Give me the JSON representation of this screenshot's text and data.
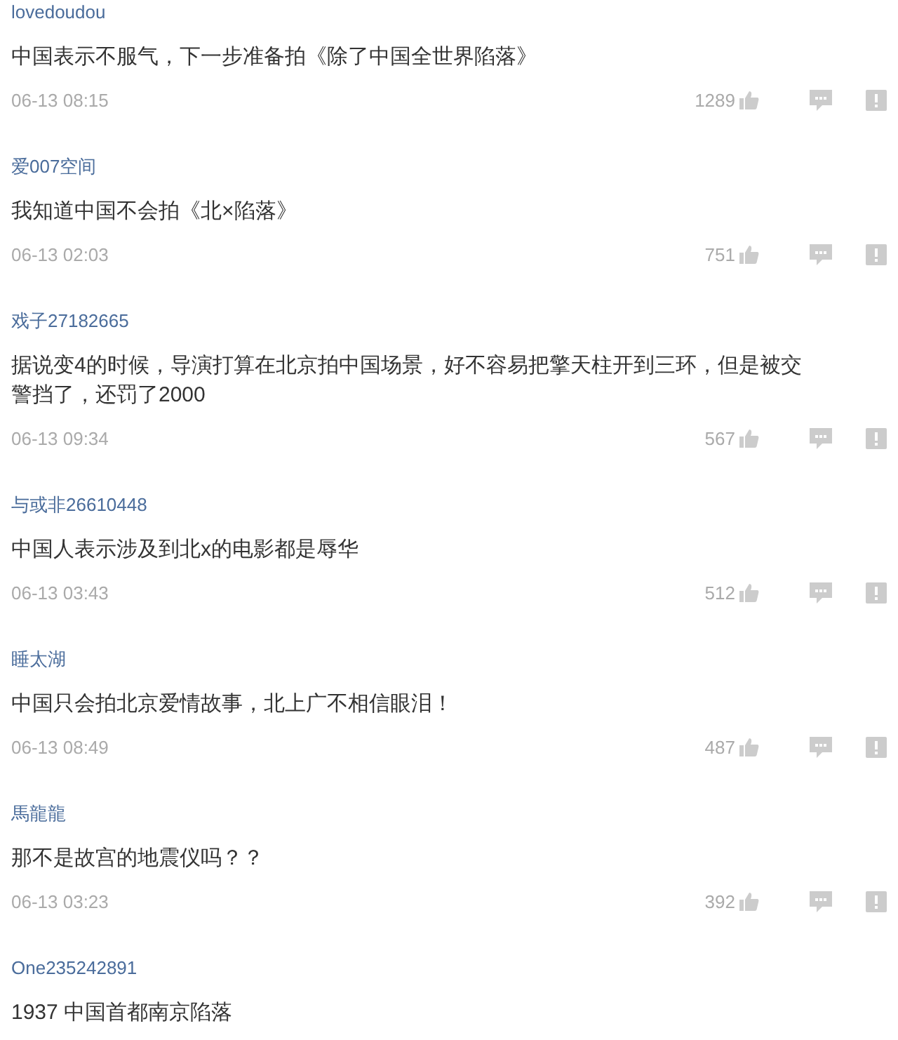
{
  "comments": [
    {
      "user": "lovedoudou",
      "text": "中国表示不服气，下一步准备拍《除了中国全世界陷落》",
      "time": "06-13 08:15",
      "likes": "1289"
    },
    {
      "user": "爱007空间",
      "text": "我知道中国不会拍《北×陷落》",
      "time": "06-13 02:03",
      "likes": "751"
    },
    {
      "user": "戏子27182665",
      "text": "据说变4的时候，导演打算在北京拍中国场景，好不容易把擎天柱开到三环，但是被交警挡了，还罚了2000",
      "time": "06-13 09:34",
      "likes": "567"
    },
    {
      "user": "与或非26610448",
      "text": "中国人表示涉及到北x的电影都是辱华",
      "time": "06-13 03:43",
      "likes": "512"
    },
    {
      "user": "睡太湖",
      "text": "中国只会拍北京爱情故事，北上广不相信眼泪！",
      "time": "06-13 08:49",
      "likes": "487"
    },
    {
      "user": "馬龍龍",
      "text": "那不是故宫的地震仪吗？？",
      "time": "06-13 03:23",
      "likes": "392"
    },
    {
      "user": "One235242891",
      "text": "1937 中国首都南京陷落"
    }
  ]
}
